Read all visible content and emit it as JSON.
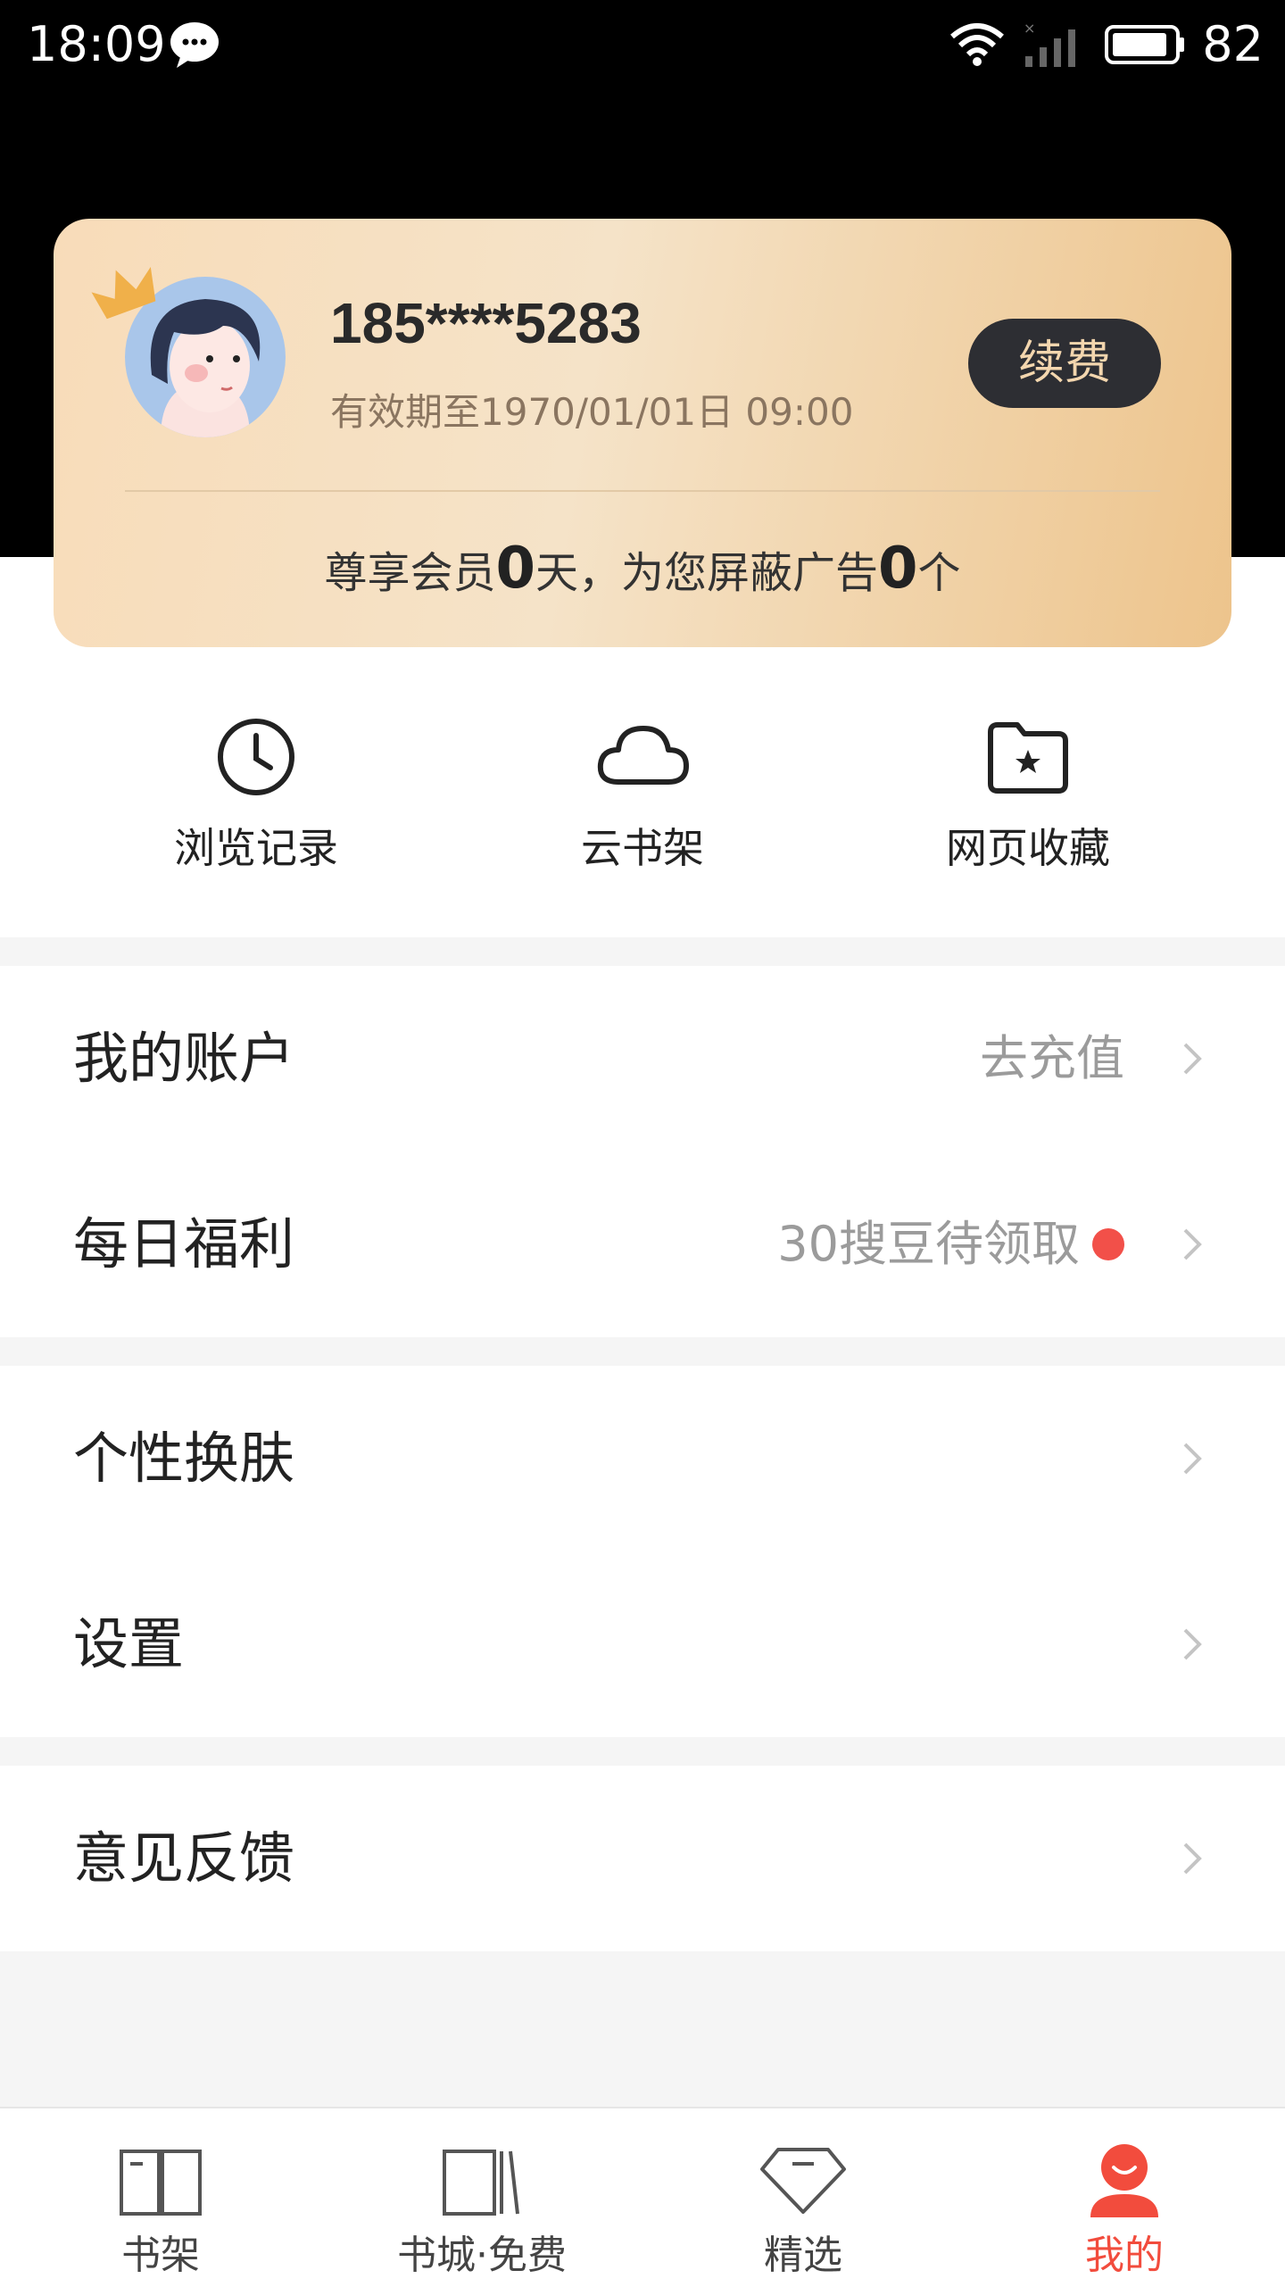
{
  "status_bar": {
    "time": "18:09",
    "battery": "82"
  },
  "profile": {
    "phone": "185****5283",
    "expiry": "有效期至1970/01/01日 09:00",
    "renew_label": "续费",
    "stats_prefix": "尊享会员",
    "member_days": "0",
    "stats_middle": "天，为您屏蔽广告",
    "ads_blocked": "0",
    "stats_suffix": "个"
  },
  "quick_actions": [
    {
      "label": "浏览记录",
      "icon": "clock-icon"
    },
    {
      "label": "云书架",
      "icon": "cloud-icon"
    },
    {
      "label": "网页收藏",
      "icon": "star-folder-icon"
    }
  ],
  "menu": {
    "account": {
      "label": "我的账户",
      "value": "去充值"
    },
    "welfare": {
      "label": "每日福利",
      "value": "30搜豆待领取"
    },
    "skin": {
      "label": "个性换肤"
    },
    "settings": {
      "label": "设置"
    },
    "feedback": {
      "label": "意见反馈"
    }
  },
  "tab_bar": [
    {
      "label": "书架",
      "icon": "book-open-icon"
    },
    {
      "label": "书城·免费",
      "icon": "bookstore-icon"
    },
    {
      "label": "精选",
      "icon": "diamond-icon"
    },
    {
      "label": "我的",
      "icon": "profile-icon",
      "active": true
    }
  ],
  "colors": {
    "accent": "#f24c3d",
    "card_gold": "#edc48c",
    "dot_red": "#f25049"
  }
}
